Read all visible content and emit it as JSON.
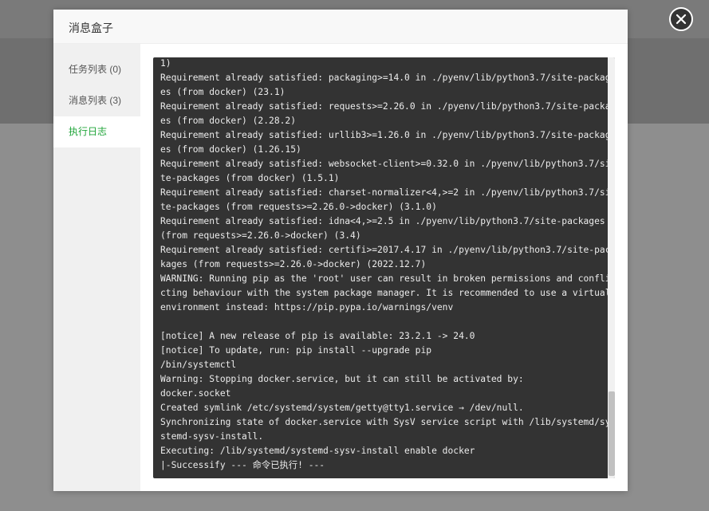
{
  "dialog": {
    "title": "消息盒子"
  },
  "sidebar": {
    "items": [
      {
        "label": "任务列表 (0)"
      },
      {
        "label": "消息列表 (3)"
      },
      {
        "label": "执行日志"
      }
    ],
    "active_index": 2
  },
  "log": {
    "lines": [
      "1)",
      "Requirement already satisfied: packaging>=14.0 in ./pyenv/lib/python3.7/site-packag",
      "es (from docker) (23.1)",
      "Requirement already satisfied: requests>=2.26.0 in ./pyenv/lib/python3.7/site-packag",
      "es (from docker) (2.28.2)",
      "Requirement already satisfied: urllib3>=1.26.0 in ./pyenv/lib/python3.7/site-packag",
      "es (from docker) (1.26.15)",
      "Requirement already satisfied: websocket-client>=0.32.0 in ./pyenv/lib/python3.7/si",
      "te-packages (from docker) (1.5.1)",
      "Requirement already satisfied: charset-normalizer<4,>=2 in ./pyenv/lib/python3.7/si",
      "te-packages (from requests>=2.26.0->docker) (3.1.0)",
      "Requirement already satisfied: idna<4,>=2.5 in ./pyenv/lib/python3.7/site-packages",
      "(from requests>=2.26.0->docker) (3.4)",
      "Requirement already satisfied: certifi>=2017.4.17 in ./pyenv/lib/python3.7/site-pac",
      "kages (from requests>=2.26.0->docker) (2022.12.7)",
      "WARNING: Running pip as the 'root' user can result in broken permissions and confli",
      "cting behaviour with the system package manager. It is recommended to use a virtual",
      "environment instead: https://pip.pypa.io/warnings/venv",
      "",
      "[notice] A new release of pip is available: 23.2.1 -> 24.0",
      "[notice] To update, run: pip install --upgrade pip",
      "/bin/systemctl",
      "Warning: Stopping docker.service, but it can still be activated by:",
      "docker.socket",
      "Created symlink /etc/systemd/system/getty@tty1.service → /dev/null.",
      "Synchronizing state of docker.service with SysV service script with /lib/systemd/sy",
      "stemd-sysv-install.",
      "Executing: /lib/systemd/systemd-sysv-install enable docker",
      "|-Successify --- 命令已执行! ---"
    ]
  },
  "icons": {
    "close": "close-icon"
  },
  "colors": {
    "accent": "#20a53a",
    "log_background": "#333333",
    "log_text": "#ececec",
    "overlay": "#8c8c8c"
  }
}
